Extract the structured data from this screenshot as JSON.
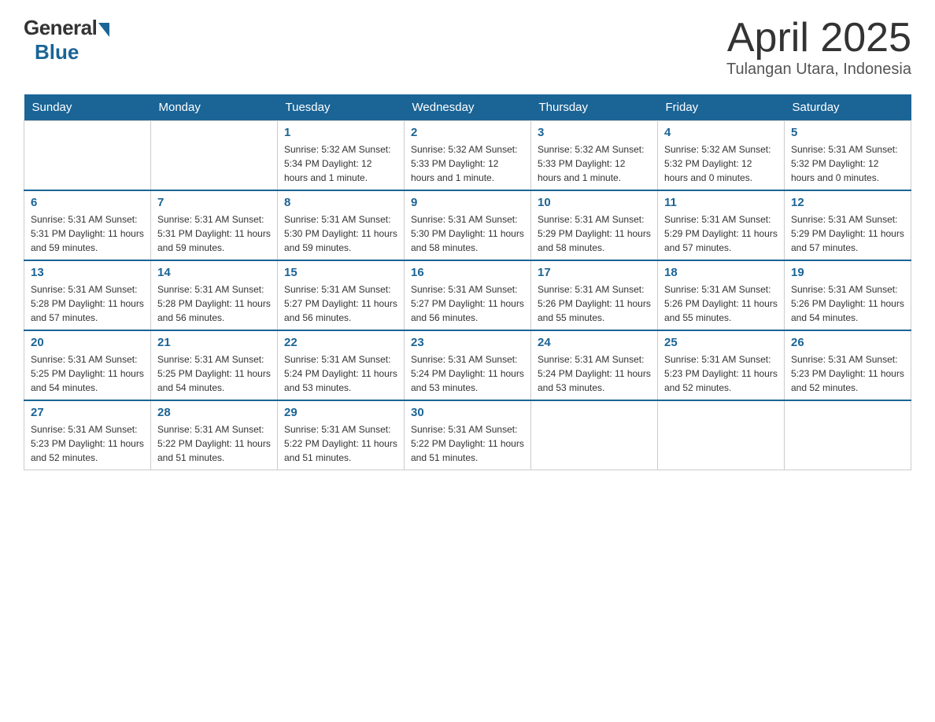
{
  "header": {
    "logo": {
      "general": "General",
      "blue": "Blue"
    },
    "title": "April 2025",
    "location": "Tulangan Utara, Indonesia"
  },
  "days_of_week": [
    "Sunday",
    "Monday",
    "Tuesday",
    "Wednesday",
    "Thursday",
    "Friday",
    "Saturday"
  ],
  "weeks": [
    [
      {
        "day": "",
        "info": ""
      },
      {
        "day": "",
        "info": ""
      },
      {
        "day": "1",
        "info": "Sunrise: 5:32 AM\nSunset: 5:34 PM\nDaylight: 12 hours\nand 1 minute."
      },
      {
        "day": "2",
        "info": "Sunrise: 5:32 AM\nSunset: 5:33 PM\nDaylight: 12 hours\nand 1 minute."
      },
      {
        "day": "3",
        "info": "Sunrise: 5:32 AM\nSunset: 5:33 PM\nDaylight: 12 hours\nand 1 minute."
      },
      {
        "day": "4",
        "info": "Sunrise: 5:32 AM\nSunset: 5:32 PM\nDaylight: 12 hours\nand 0 minutes."
      },
      {
        "day": "5",
        "info": "Sunrise: 5:31 AM\nSunset: 5:32 PM\nDaylight: 12 hours\nand 0 minutes."
      }
    ],
    [
      {
        "day": "6",
        "info": "Sunrise: 5:31 AM\nSunset: 5:31 PM\nDaylight: 11 hours\nand 59 minutes."
      },
      {
        "day": "7",
        "info": "Sunrise: 5:31 AM\nSunset: 5:31 PM\nDaylight: 11 hours\nand 59 minutes."
      },
      {
        "day": "8",
        "info": "Sunrise: 5:31 AM\nSunset: 5:30 PM\nDaylight: 11 hours\nand 59 minutes."
      },
      {
        "day": "9",
        "info": "Sunrise: 5:31 AM\nSunset: 5:30 PM\nDaylight: 11 hours\nand 58 minutes."
      },
      {
        "day": "10",
        "info": "Sunrise: 5:31 AM\nSunset: 5:29 PM\nDaylight: 11 hours\nand 58 minutes."
      },
      {
        "day": "11",
        "info": "Sunrise: 5:31 AM\nSunset: 5:29 PM\nDaylight: 11 hours\nand 57 minutes."
      },
      {
        "day": "12",
        "info": "Sunrise: 5:31 AM\nSunset: 5:29 PM\nDaylight: 11 hours\nand 57 minutes."
      }
    ],
    [
      {
        "day": "13",
        "info": "Sunrise: 5:31 AM\nSunset: 5:28 PM\nDaylight: 11 hours\nand 57 minutes."
      },
      {
        "day": "14",
        "info": "Sunrise: 5:31 AM\nSunset: 5:28 PM\nDaylight: 11 hours\nand 56 minutes."
      },
      {
        "day": "15",
        "info": "Sunrise: 5:31 AM\nSunset: 5:27 PM\nDaylight: 11 hours\nand 56 minutes."
      },
      {
        "day": "16",
        "info": "Sunrise: 5:31 AM\nSunset: 5:27 PM\nDaylight: 11 hours\nand 56 minutes."
      },
      {
        "day": "17",
        "info": "Sunrise: 5:31 AM\nSunset: 5:26 PM\nDaylight: 11 hours\nand 55 minutes."
      },
      {
        "day": "18",
        "info": "Sunrise: 5:31 AM\nSunset: 5:26 PM\nDaylight: 11 hours\nand 55 minutes."
      },
      {
        "day": "19",
        "info": "Sunrise: 5:31 AM\nSunset: 5:26 PM\nDaylight: 11 hours\nand 54 minutes."
      }
    ],
    [
      {
        "day": "20",
        "info": "Sunrise: 5:31 AM\nSunset: 5:25 PM\nDaylight: 11 hours\nand 54 minutes."
      },
      {
        "day": "21",
        "info": "Sunrise: 5:31 AM\nSunset: 5:25 PM\nDaylight: 11 hours\nand 54 minutes."
      },
      {
        "day": "22",
        "info": "Sunrise: 5:31 AM\nSunset: 5:24 PM\nDaylight: 11 hours\nand 53 minutes."
      },
      {
        "day": "23",
        "info": "Sunrise: 5:31 AM\nSunset: 5:24 PM\nDaylight: 11 hours\nand 53 minutes."
      },
      {
        "day": "24",
        "info": "Sunrise: 5:31 AM\nSunset: 5:24 PM\nDaylight: 11 hours\nand 53 minutes."
      },
      {
        "day": "25",
        "info": "Sunrise: 5:31 AM\nSunset: 5:23 PM\nDaylight: 11 hours\nand 52 minutes."
      },
      {
        "day": "26",
        "info": "Sunrise: 5:31 AM\nSunset: 5:23 PM\nDaylight: 11 hours\nand 52 minutes."
      }
    ],
    [
      {
        "day": "27",
        "info": "Sunrise: 5:31 AM\nSunset: 5:23 PM\nDaylight: 11 hours\nand 52 minutes."
      },
      {
        "day": "28",
        "info": "Sunrise: 5:31 AM\nSunset: 5:22 PM\nDaylight: 11 hours\nand 51 minutes."
      },
      {
        "day": "29",
        "info": "Sunrise: 5:31 AM\nSunset: 5:22 PM\nDaylight: 11 hours\nand 51 minutes."
      },
      {
        "day": "30",
        "info": "Sunrise: 5:31 AM\nSunset: 5:22 PM\nDaylight: 11 hours\nand 51 minutes."
      },
      {
        "day": "",
        "info": ""
      },
      {
        "day": "",
        "info": ""
      },
      {
        "day": "",
        "info": ""
      }
    ]
  ]
}
